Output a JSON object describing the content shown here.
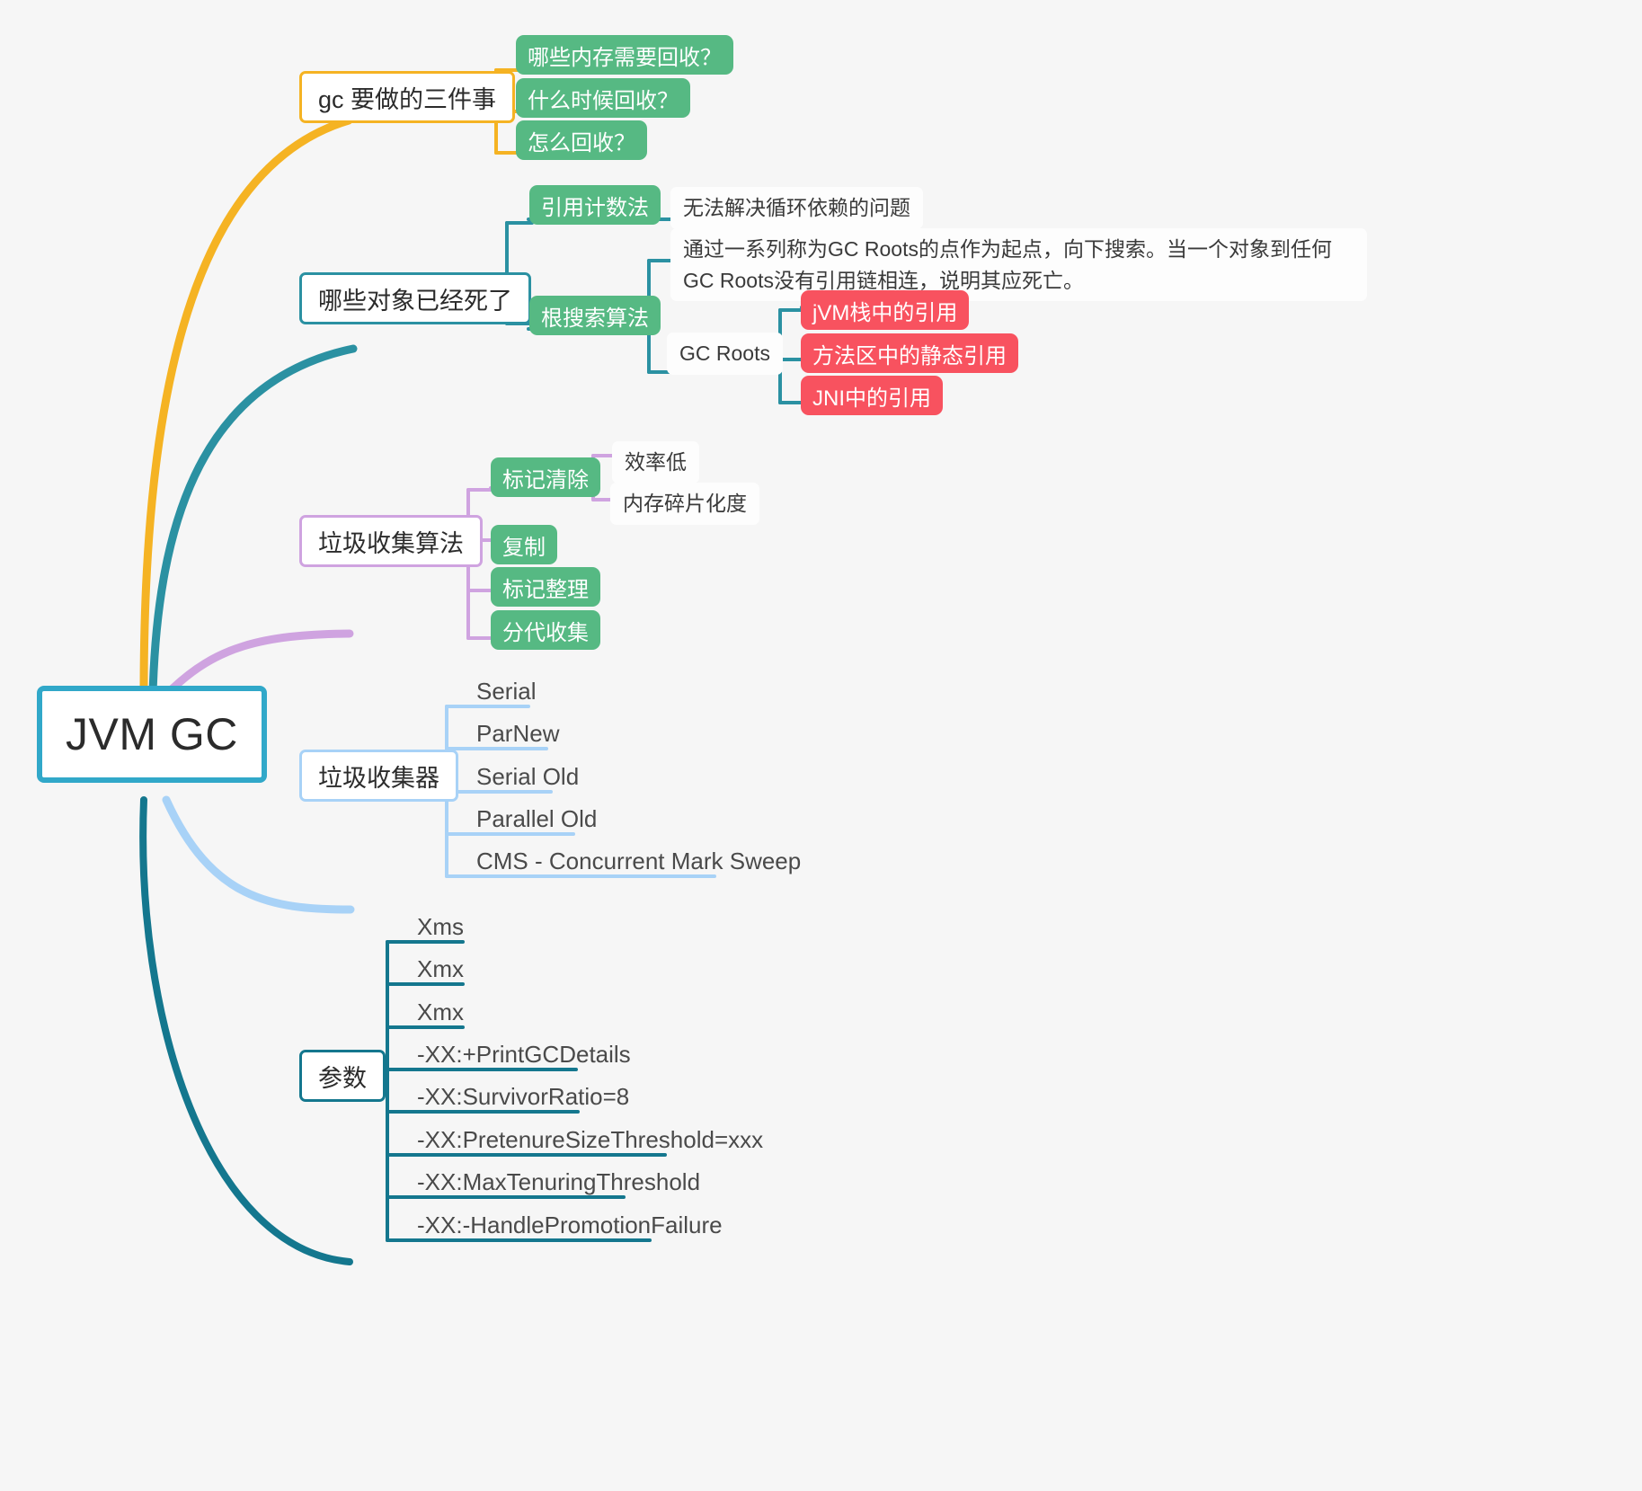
{
  "diagram": {
    "title": "JVM GC",
    "type": "mind-map",
    "background": "#f6f6f6",
    "palette": {
      "root": "#31a8c9",
      "orange": "#f5b323",
      "teal": "#2b91a2",
      "violet": "#cfa3e0",
      "blue": "#a8d2f7",
      "dark_teal": "#14778e",
      "green_fill": "#56b983",
      "red_fill": "#f8525f",
      "card_bg": "#fdfdfd",
      "text": "#3a3a3a"
    }
  },
  "root": {
    "label": "JVM GC"
  },
  "branches": [
    {
      "id": "gc-three-things",
      "label": "gc 要做的三件事",
      "color": "#f5b323",
      "children": [
        {
          "label": "哪些内存需要回收？"
        },
        {
          "label": "什么时候回收？"
        },
        {
          "label": "怎么回收？"
        }
      ]
    },
    {
      "id": "which-objects-dead",
      "label": "哪些对象已经死了",
      "color": "#2b91a2",
      "children": [
        {
          "label": "引用计数法",
          "children": [
            {
              "label": "无法解决循环依赖的问题"
            }
          ]
        },
        {
          "label": "根搜索算法",
          "children": [
            {
              "label": "通过一系列称为GC Roots的点作为起点，向下搜索。当一个对象到任何GC Roots没有引用链相连，说明其应死亡。"
            },
            {
              "label": "GC Roots",
              "children": [
                {
                  "label": "jVM栈中的引用"
                },
                {
                  "label": "方法区中的静态引用"
                },
                {
                  "label": "JNI中的引用"
                }
              ]
            }
          ]
        }
      ]
    },
    {
      "id": "gc-algorithms",
      "label": "垃圾收集算法",
      "color": "#cfa3e0",
      "children": [
        {
          "label": "标记清除",
          "children": [
            {
              "label": "效率低"
            },
            {
              "label": "内存碎片化度"
            }
          ]
        },
        {
          "label": "复制"
        },
        {
          "label": "标记整理"
        },
        {
          "label": "分代收集"
        }
      ]
    },
    {
      "id": "gc-collectors",
      "label": "垃圾收集器",
      "color": "#a8d2f7",
      "children": [
        {
          "label": "Serial"
        },
        {
          "label": "ParNew"
        },
        {
          "label": "Serial Old"
        },
        {
          "label": "Parallel Old"
        },
        {
          "label": "CMS - Concurrent Mark Sweep"
        }
      ]
    },
    {
      "id": "parameters",
      "label": "参数",
      "color": "#14778e",
      "children": [
        {
          "label": "Xms"
        },
        {
          "label": "Xmx"
        },
        {
          "label": "Xmx"
        },
        {
          "label": "-XX:+PrintGCDetails"
        },
        {
          "label": "-XX:SurvivorRatio=8"
        },
        {
          "label": "-XX:PretenureSizeThreshold=xxx"
        },
        {
          "label": "-XX:MaxTenuringThreshold"
        },
        {
          "label": "-XX:-HandlePromotionFailure"
        }
      ]
    }
  ]
}
